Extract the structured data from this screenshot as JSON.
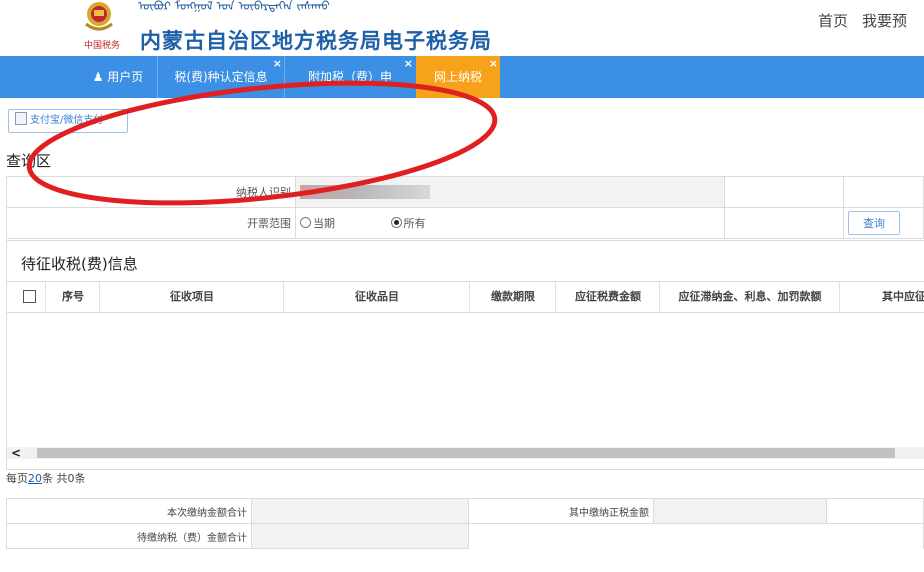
{
  "header": {
    "mongolian_script": "ᠦᠪᠦᠷ ᠮᠣᠩᠭᠣᠯ ᠤᠨ ᠥᠪᠡᠷᠲᠡᠭᠡᠨ ᠵᠠᠰᠠᠬᠤ",
    "seal_text": "中国税务",
    "site_title": "内蒙古自治区地方税务局电子税务局",
    "links": [
      "首页",
      "我要预"
    ]
  },
  "nav": {
    "tabs": [
      {
        "label": "用户页",
        "closable": false,
        "active": false
      },
      {
        "label": "税(费)种认定信息",
        "closable": true,
        "active": false
      },
      {
        "label": "附加税（费）申",
        "closable": true,
        "active": false
      },
      {
        "label": "网上纳税",
        "closable": true,
        "active": true
      }
    ],
    "close_glyph": "×"
  },
  "toolbar": {
    "pay_button": "支付宝/微信支付"
  },
  "query": {
    "section_title": "查询区",
    "taxpayer_id_label": "纳税人识别",
    "invoice_range_label": "开票范围",
    "options": [
      "当期",
      "所有"
    ],
    "selected": "所有",
    "query_button": "查询"
  },
  "pending": {
    "title": "待征收税(费)信息",
    "columns": [
      "序号",
      "征收项目",
      "征收品目",
      "缴款期限",
      "应征税费金额",
      "应征滞纳金、利息、加罚款额",
      "其中应征"
    ],
    "rows": []
  },
  "pager": {
    "prefix": "每页",
    "page_size": "20",
    "suffix": "条 共0条"
  },
  "summary": {
    "this_payment_total": "本次缴纳金额合计",
    "tax_amount_in_payment": "其中缴纳正税金额",
    "pending_total": "待缴纳税（费）金额合计"
  },
  "colors": {
    "nav_bg": "#3b8fe5",
    "active_tab": "#f7a21b",
    "title_blue": "#1d5fa8",
    "annotation_red": "#e02020"
  }
}
